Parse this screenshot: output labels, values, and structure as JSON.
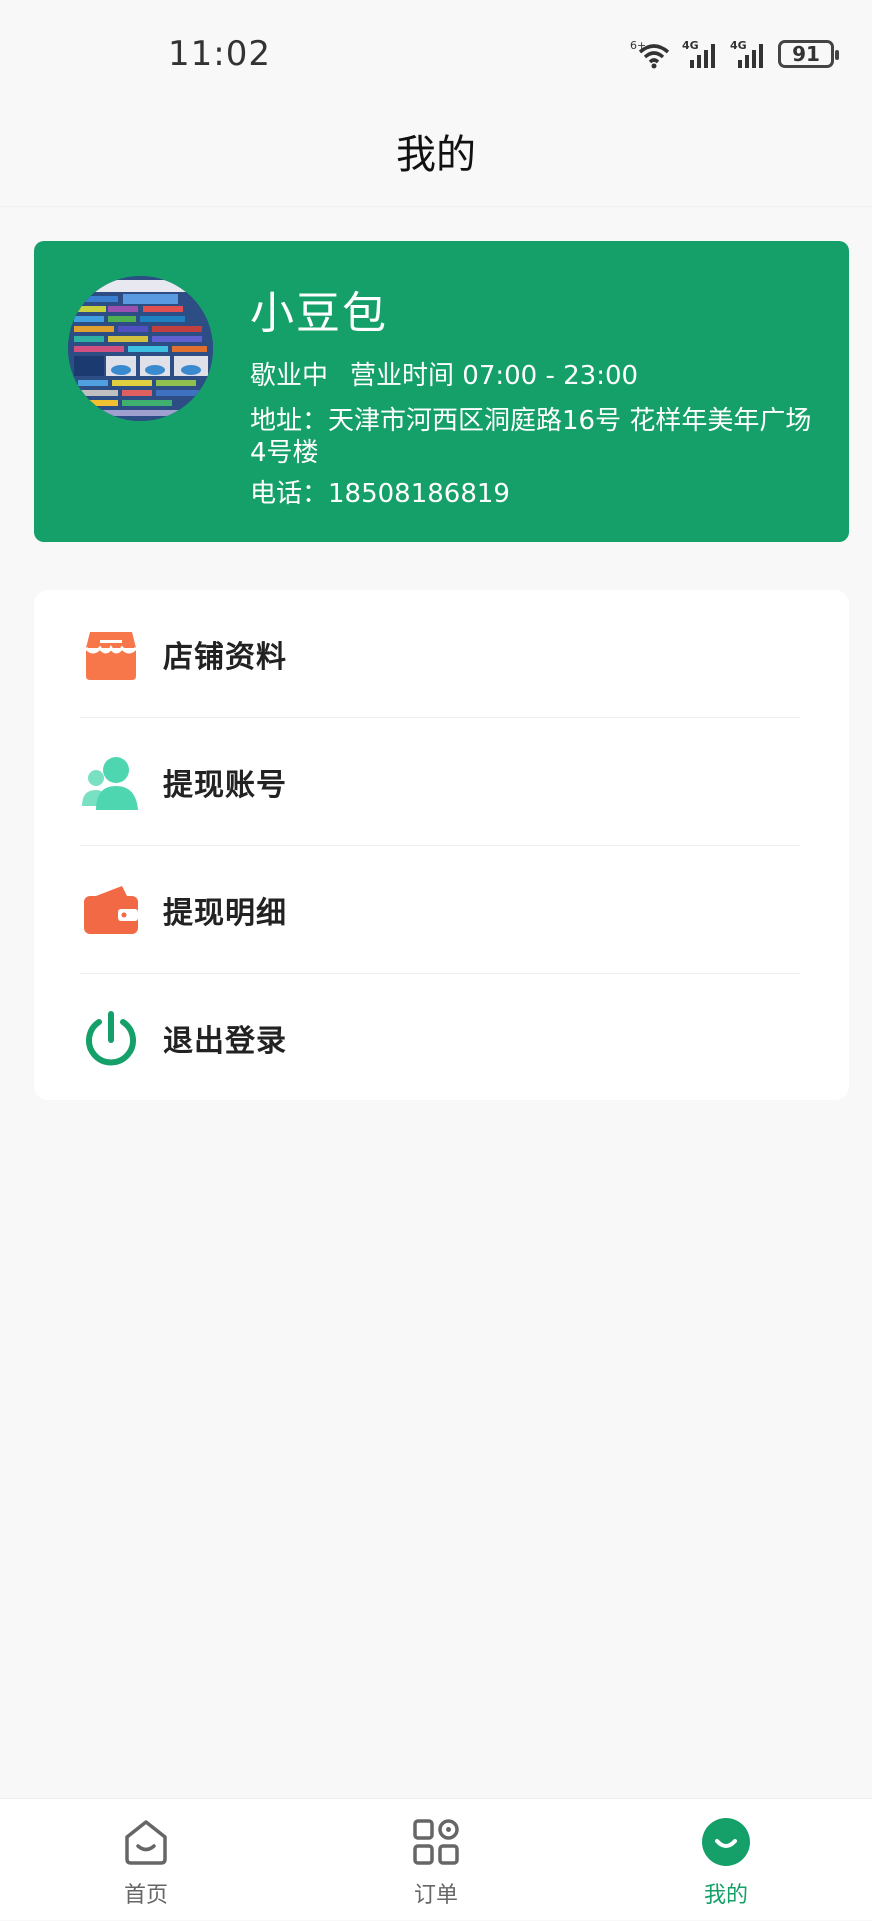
{
  "status_bar": {
    "time": "11:02",
    "battery": "91",
    "network_1": "4G",
    "network_2": "4G",
    "wifi_label": "6+"
  },
  "header": {
    "title": "我的"
  },
  "shop": {
    "name": "小豆包",
    "status": "歇业中",
    "hours": "营业时间 07:00 - 23:00",
    "address": "地址：天津市河西区洞庭路16号 花样年美年广场 4号楼",
    "phone": "电话：18508186819",
    "avatar_icon": "sql-cheatsheet-avatar"
  },
  "menu": {
    "items": [
      {
        "label": "店铺资料",
        "icon": "store-icon"
      },
      {
        "label": "提现账号",
        "icon": "user-account-icon"
      },
      {
        "label": "提现明细",
        "icon": "wallet-icon"
      },
      {
        "label": "退出登录",
        "icon": "power-icon"
      }
    ]
  },
  "tabbar": {
    "tabs": [
      {
        "label": "首页",
        "icon": "home-icon"
      },
      {
        "label": "订单",
        "icon": "grid-icon"
      },
      {
        "label": "我的",
        "icon": "smile-icon",
        "active": true
      }
    ]
  },
  "colors": {
    "brand_green": "#14a068",
    "store_orange": "#f7764a",
    "account_teal": "#4dd6b0",
    "wallet_red": "#f26a45"
  }
}
